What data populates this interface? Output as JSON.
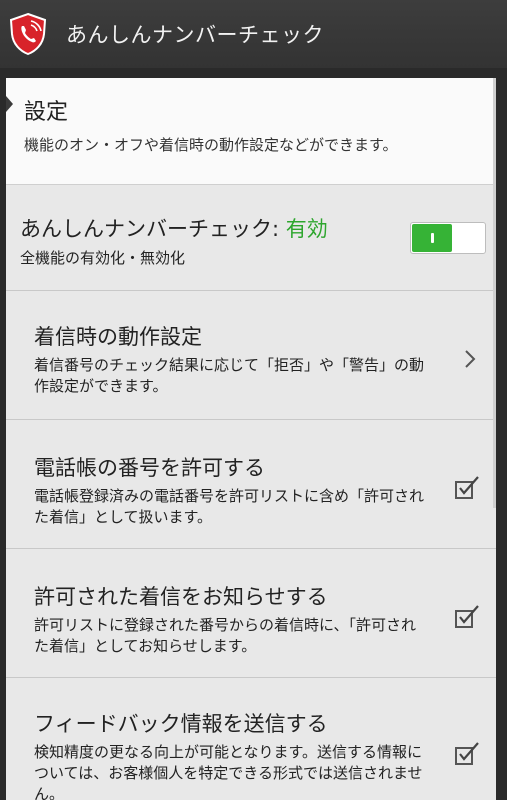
{
  "app_bar": {
    "title": "あんしんナンバーチェック",
    "icon": "shield-phone-icon",
    "icon_color": "#d8232a"
  },
  "header": {
    "title": "設定",
    "subtitle": "機能のオン・オフや着信時の動作設定などができます。"
  },
  "master": {
    "label": "あんしんナンバーチェック:",
    "status": "有効",
    "status_color": "#2ea62e",
    "description": "全機能の有効化・無効化",
    "toggle_on": true
  },
  "items": [
    {
      "title": "着信時の動作設定",
      "description": "着信番号のチェック結果に応じて「拒否」や「警告」の動作設定ができます。",
      "control": "chevron-right-icon"
    },
    {
      "title": "電話帳の番号を許可する",
      "description": "電話帳登録済みの電話番号を許可リストに含め「許可された着信」として扱います。",
      "checked": true
    },
    {
      "title": "許可された着信をお知らせする",
      "description": "許可リストに登録された番号からの着信時に、「許可された着信」としてお知らせします。",
      "checked": true
    },
    {
      "title": "フィードバック情報を送信する",
      "description": "検知精度の更なる向上が可能となります。送信する情報については、お客様個人を特定できる形式では送信されません。",
      "checked": true
    }
  ]
}
